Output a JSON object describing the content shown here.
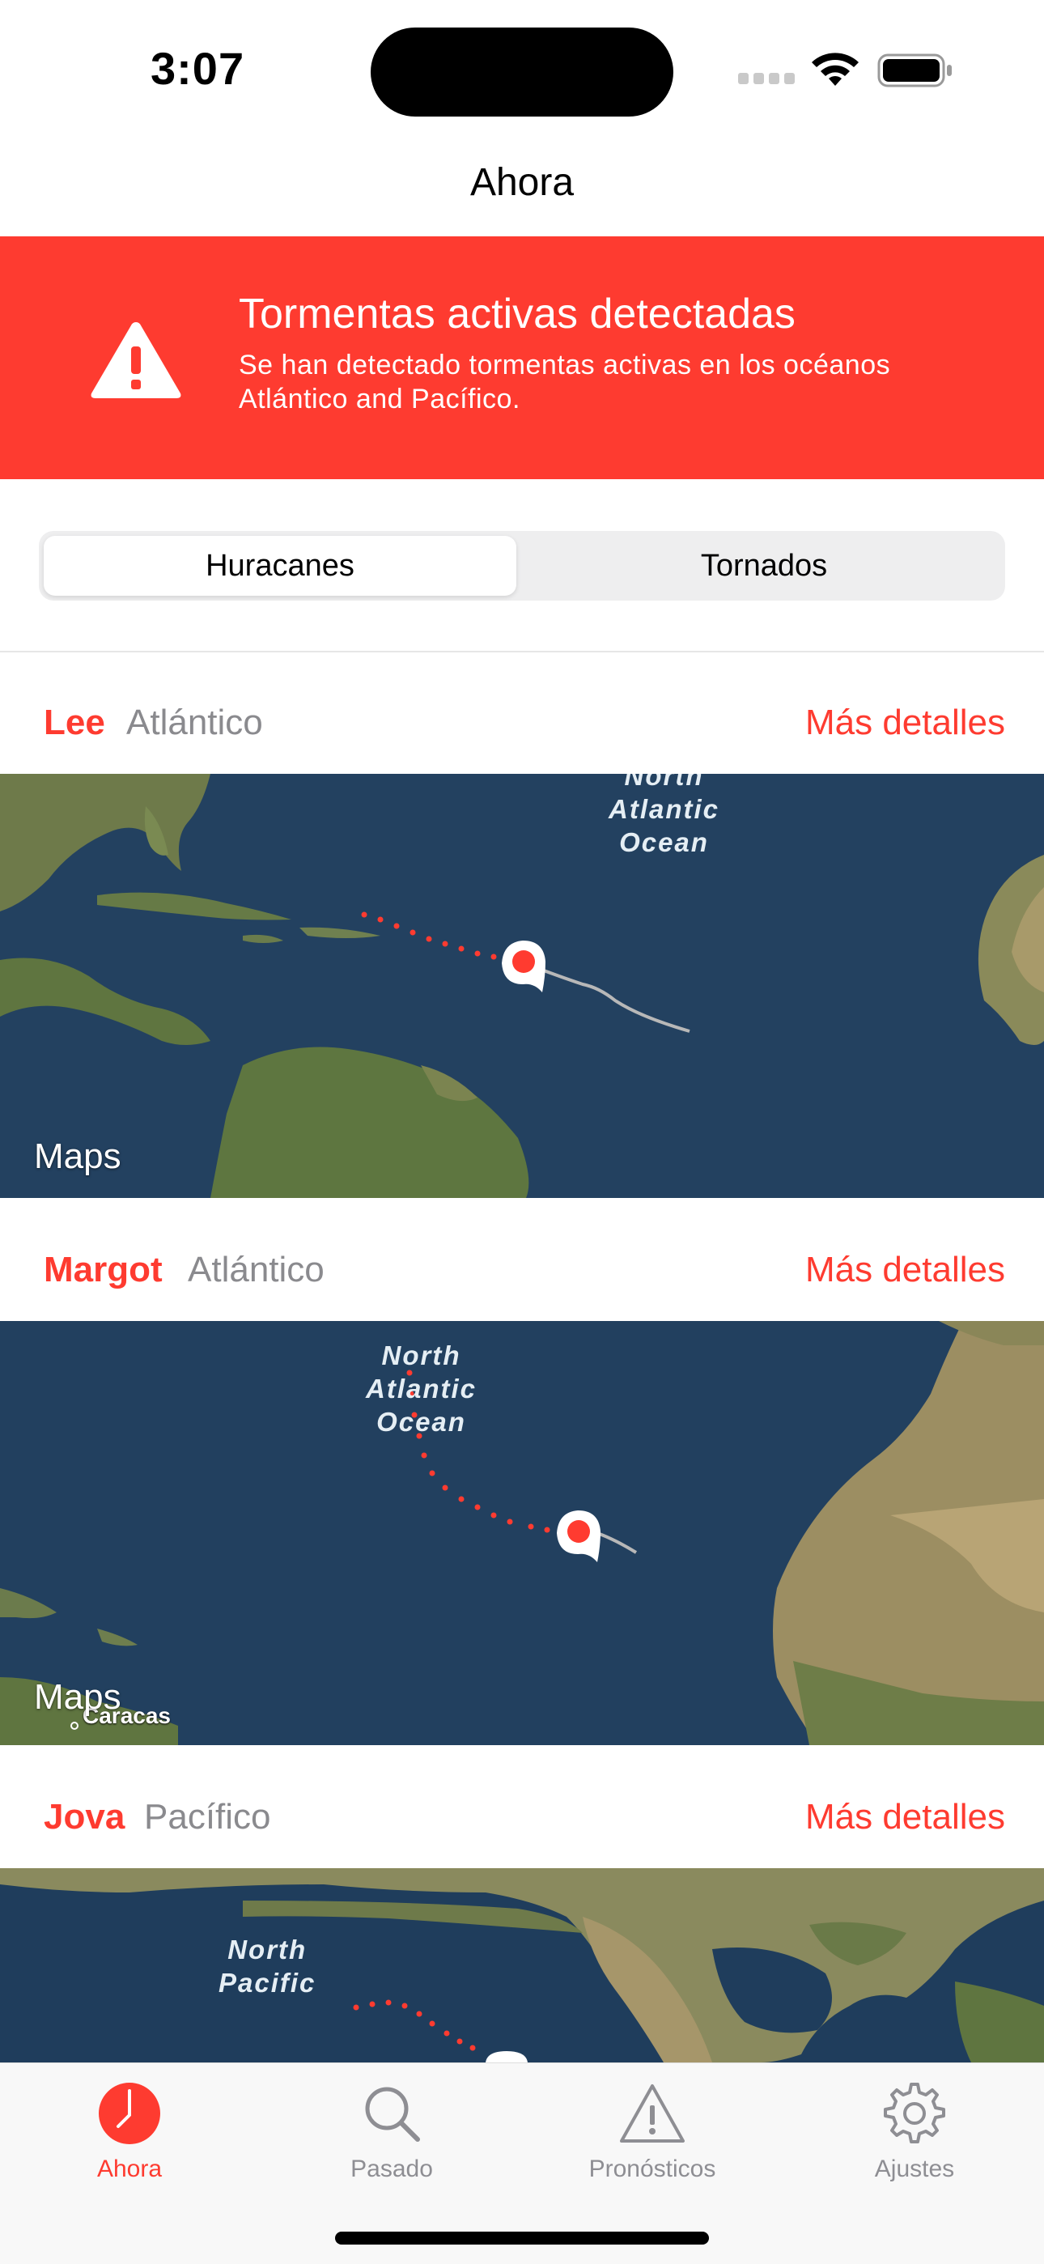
{
  "status": {
    "time": "3:07"
  },
  "nav": {
    "title": "Ahora"
  },
  "alert": {
    "title": "Tormentas activas detectadas",
    "body": "Se han detectado tormentas activas en los océanos Atlántico and Pacífico."
  },
  "segmented": {
    "options": [
      "Huracanes",
      "Tornados"
    ],
    "selected": "Huracanes"
  },
  "storms": [
    {
      "name": "Lee",
      "ocean": "Atlántico",
      "link": "Más detalles",
      "map": {
        "ocean_label": [
          "North",
          "Atlantic",
          "Ocean"
        ],
        "logo": "Maps"
      }
    },
    {
      "name": "Margot",
      "ocean": "Atlántico",
      "link": "Más detalles",
      "map": {
        "ocean_label": [
          "North",
          "Atlantic",
          "Ocean"
        ],
        "logo": "Maps",
        "city": "Caracas"
      }
    },
    {
      "name": "Jova",
      "ocean": "Pacífico",
      "link": "Más detalles",
      "map": {
        "ocean_label": [
          "North",
          "Pacific"
        ]
      }
    }
  ],
  "tabs": [
    {
      "label": "Ahora",
      "icon": "clock-icon",
      "active": true
    },
    {
      "label": "Pasado",
      "icon": "magnifier-icon",
      "active": false
    },
    {
      "label": "Pronósticos",
      "icon": "warning-triangle-icon",
      "active": false
    },
    {
      "label": "Ajustes",
      "icon": "gear-icon",
      "active": false
    }
  ],
  "colors": {
    "accent": "#fe3b30",
    "secondary_text": "#8a8a8e",
    "ocean": "#1d3b5a",
    "land": "#6e7a4a"
  }
}
